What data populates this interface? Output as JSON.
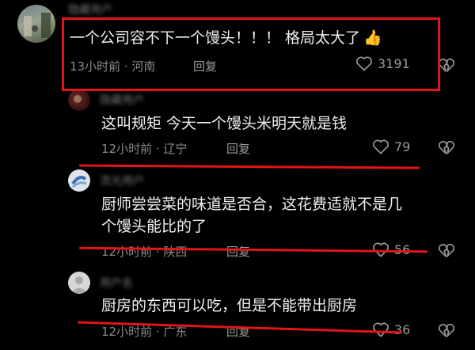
{
  "comments": [
    {
      "username": "隐藏用户",
      "text": "一个公司容不下一个馒头！！！ 格局太大了",
      "emoji": "👍",
      "time": "13小时前",
      "location": "河南",
      "reply_label": "回复",
      "likes": "3191"
    },
    {
      "username": "隐藏用户",
      "text": "这叫规矩 今天一个馒头米明天就是钱",
      "time": "12小时前",
      "location": "辽宁",
      "reply_label": "回复",
      "likes": "79"
    },
    {
      "username": "流光用户",
      "text_line1": "厨师尝尝菜的味道是否合，这花费适就不是几",
      "text_line2": "个馒头能比的了",
      "time": "12小时前",
      "location": "陕西",
      "reply_label": "回复",
      "likes": "56"
    },
    {
      "username": "用户名",
      "text": "厨房的东西可以吃，但是不能带出厨房",
      "time": "12小时前",
      "location": "广东",
      "reply_label": "回复",
      "likes": "36"
    }
  ],
  "colors": {
    "background": "#000000",
    "annotation_red": "#e3141a",
    "meta_gray": "#8a8a8a"
  },
  "icons": [
    "heart-outline-icon",
    "broken-heart-icon",
    "thumbs-up-emoji"
  ]
}
